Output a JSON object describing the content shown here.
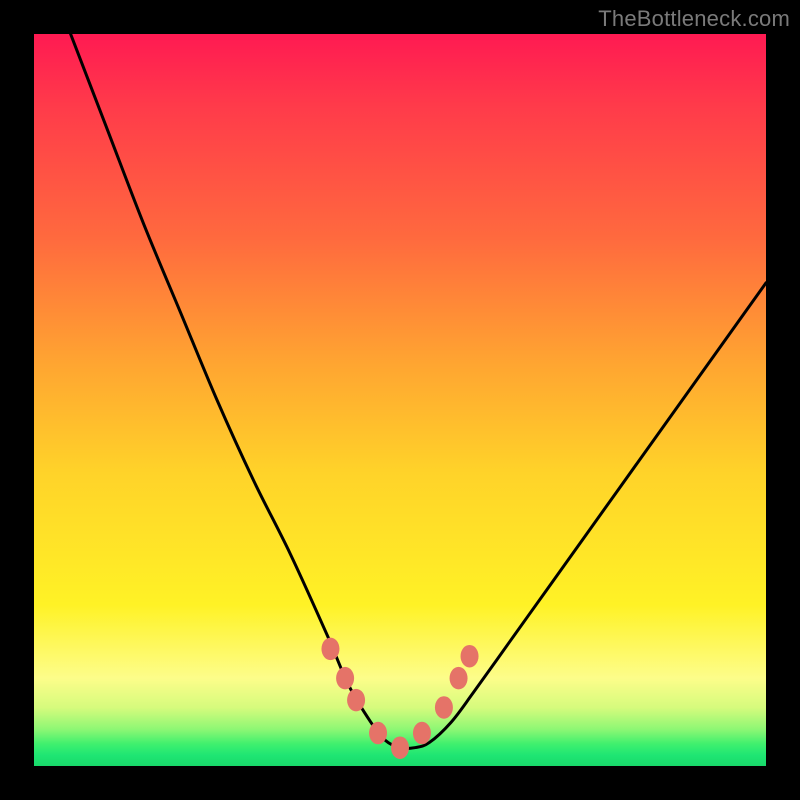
{
  "watermark": {
    "text": "TheBottleneck.com"
  },
  "chart_data": {
    "type": "line",
    "title": "",
    "xlabel": "",
    "ylabel": "",
    "xlim": [
      0,
      100
    ],
    "ylim": [
      0,
      100
    ],
    "series": [
      {
        "name": "bottleneck-curve",
        "x": [
          5,
          10,
          15,
          20,
          25,
          30,
          35,
          40,
          43,
          46,
          48,
          50,
          52,
          54,
          57,
          60,
          65,
          70,
          75,
          80,
          85,
          90,
          95,
          100
        ],
        "values": [
          100,
          87,
          74,
          62,
          50,
          39,
          29,
          18,
          11,
          6,
          3.5,
          2.5,
          2.5,
          3.2,
          6,
          10,
          17,
          24,
          31,
          38,
          45,
          52,
          59,
          66
        ]
      }
    ],
    "markers": {
      "name": "threshold-markers",
      "x": [
        40.5,
        42.5,
        44,
        47,
        50,
        53,
        56,
        58,
        59.5
      ],
      "values": [
        16,
        12,
        9,
        4.5,
        2.5,
        4.5,
        8,
        12,
        15
      ],
      "color": "#e57368",
      "radius_px": 9
    },
    "annotations": []
  }
}
